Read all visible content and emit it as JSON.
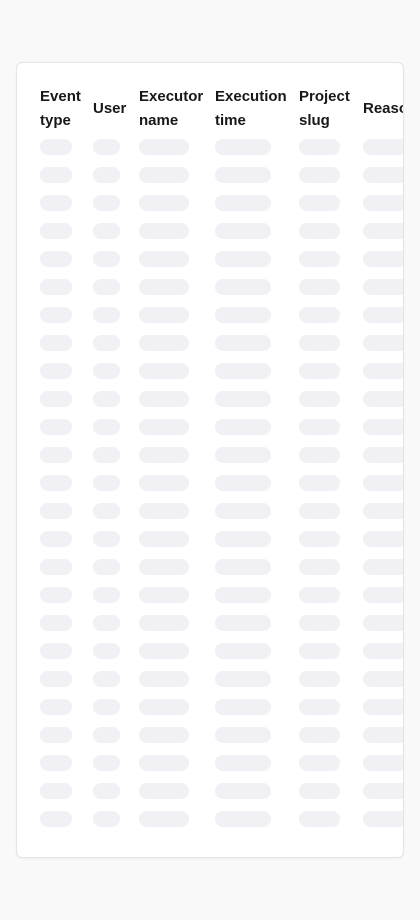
{
  "table": {
    "columns": [
      {
        "key": "event_type",
        "label": "Event\ntype"
      },
      {
        "key": "user",
        "label": "User"
      },
      {
        "key": "executor_name",
        "label": "Executor\nname"
      },
      {
        "key": "execution_time",
        "label": "Execution\ntime"
      },
      {
        "key": "project_slug",
        "label": "Project\nslug"
      },
      {
        "key": "reason",
        "label": "Reason"
      }
    ],
    "loading": true,
    "skeleton_row_count": 25
  },
  "colors": {
    "page_background": "#f9f9f9",
    "card_background": "#ffffff",
    "skeleton": "#f0f0f5",
    "header_text": "#18181b"
  }
}
